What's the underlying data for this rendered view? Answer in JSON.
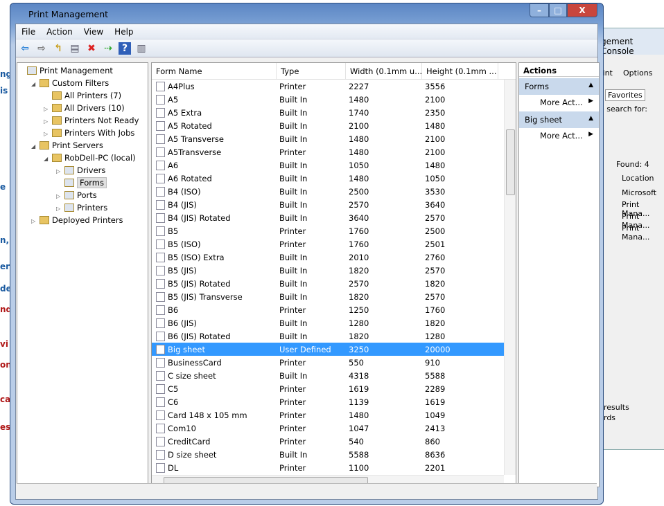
{
  "window": {
    "title": "Print Management",
    "minimize": "–",
    "maximize": "□",
    "close": "X"
  },
  "menu": [
    "File",
    "Action",
    "View",
    "Help"
  ],
  "toolbar": [
    {
      "icon": "back-arrow-icon",
      "g": "⇦",
      "c": "#1e7bd6"
    },
    {
      "icon": "forward-arrow-icon",
      "g": "⇨",
      "c": "#777"
    },
    {
      "icon": "up-folder-icon",
      "g": "↰",
      "c": "#c9a020"
    },
    {
      "icon": "show-hide-tree-icon",
      "g": "▤",
      "c": "#556"
    },
    {
      "icon": "delete-icon",
      "g": "✖",
      "c": "#d22"
    },
    {
      "icon": "export-list-icon",
      "g": "⇢",
      "c": "#3a3"
    },
    {
      "icon": "help-icon",
      "g": "?",
      "c": "#fff"
    },
    {
      "icon": "show-hide-action-pane-icon",
      "g": "▥",
      "c": "#556"
    }
  ],
  "tree": [
    {
      "label": "Print Management",
      "lvl": 0,
      "tog": ""
    },
    {
      "label": "Custom Filters",
      "lvl": 1,
      "tog": "◢"
    },
    {
      "label": "All Printers (7)",
      "lvl": 2,
      "tog": ""
    },
    {
      "label": "All Drivers (10)",
      "lvl": 2,
      "tog": "▷"
    },
    {
      "label": "Printers Not Ready",
      "lvl": 2,
      "tog": "▷"
    },
    {
      "label": "Printers With Jobs",
      "lvl": 2,
      "tog": "▷"
    },
    {
      "label": "Print Servers",
      "lvl": 1,
      "tog": "◢"
    },
    {
      "label": "RobDell-PC (local)",
      "lvl": 2,
      "tog": "◢"
    },
    {
      "label": "Drivers",
      "lvl": 3,
      "tog": "▷"
    },
    {
      "label": "Forms",
      "lvl": 3,
      "tog": "",
      "selected": true
    },
    {
      "label": "Ports",
      "lvl": 3,
      "tog": "▷"
    },
    {
      "label": "Printers",
      "lvl": 3,
      "tog": "▷"
    },
    {
      "label": "Deployed Printers",
      "lvl": 1,
      "tog": "▷"
    }
  ],
  "list": {
    "columns": [
      "Form Name",
      "Type",
      "Width (0.1mm u...",
      "Height (0.1mm ..."
    ],
    "rows": [
      [
        "A4Plus",
        "Printer",
        "2227",
        "3556"
      ],
      [
        "A5",
        "Built In",
        "1480",
        "2100"
      ],
      [
        "A5 Extra",
        "Built In",
        "1740",
        "2350"
      ],
      [
        "A5 Rotated",
        "Built In",
        "2100",
        "1480"
      ],
      [
        "A5 Transverse",
        "Built In",
        "1480",
        "2100"
      ],
      [
        "A5Transverse",
        "Printer",
        "1480",
        "2100"
      ],
      [
        "A6",
        "Built In",
        "1050",
        "1480"
      ],
      [
        "A6 Rotated",
        "Built In",
        "1480",
        "1050"
      ],
      [
        "B4 (ISO)",
        "Built In",
        "2500",
        "3530"
      ],
      [
        "B4 (JIS)",
        "Built In",
        "2570",
        "3640"
      ],
      [
        "B4 (JIS) Rotated",
        "Built In",
        "3640",
        "2570"
      ],
      [
        "B5",
        "Printer",
        "1760",
        "2500"
      ],
      [
        "B5 (ISO)",
        "Printer",
        "1760",
        "2501"
      ],
      [
        "B5 (ISO) Extra",
        "Built In",
        "2010",
        "2760"
      ],
      [
        "B5 (JIS)",
        "Built In",
        "1820",
        "2570"
      ],
      [
        "B5 (JIS) Rotated",
        "Built In",
        "2570",
        "1820"
      ],
      [
        "B5 (JIS) Transverse",
        "Built In",
        "1820",
        "2570"
      ],
      [
        "B6",
        "Printer",
        "1250",
        "1760"
      ],
      [
        "B6 (JIS)",
        "Built In",
        "1280",
        "1820"
      ],
      [
        "B6 (JIS) Rotated",
        "Built In",
        "1820",
        "1280"
      ],
      [
        "Big sheet",
        "User Defined",
        "3250",
        "20000"
      ],
      [
        "BusinessCard",
        "Printer",
        "550",
        "910"
      ],
      [
        "C size sheet",
        "Built In",
        "4318",
        "5588"
      ],
      [
        "C5",
        "Printer",
        "1619",
        "2289"
      ],
      [
        "C6",
        "Printer",
        "1139",
        "1619"
      ],
      [
        "Card 148 x 105 mm",
        "Printer",
        "1480",
        "1049"
      ],
      [
        "Com10",
        "Printer",
        "1047",
        "2413"
      ],
      [
        "CreditCard",
        "Printer",
        "540",
        "860"
      ],
      [
        "D size sheet",
        "Built In",
        "5588",
        "8636"
      ],
      [
        "DL",
        "Printer",
        "1100",
        "2201"
      ]
    ],
    "selected_index": 20
  },
  "actions": {
    "header": "Actions",
    "groups": [
      {
        "title": "Forms",
        "item": "More Act..."
      },
      {
        "title": "Big sheet",
        "item": "More Act..."
      }
    ]
  },
  "background_console": {
    "title": "gement Console",
    "print": "rint",
    "options": "Options",
    "tab": "Favorites",
    "search": "o search for:",
    "found": "Found: 4",
    "location_header": "Location",
    "locations": [
      "Microsoft ...",
      "Print Mana...",
      "Print Mana...",
      "Print Mana..."
    ],
    "results": "results",
    "rds": "rds"
  },
  "background_left": [
    "ng",
    "is",
    "e",
    "n,",
    "ers",
    "des",
    "nd",
    "vi",
    "ons",
    "ca",
    "es."
  ],
  "colors": {
    "selection": "#3399ff",
    "titlebar": "#5b86c4",
    "action_group": "#c9d9ec"
  }
}
